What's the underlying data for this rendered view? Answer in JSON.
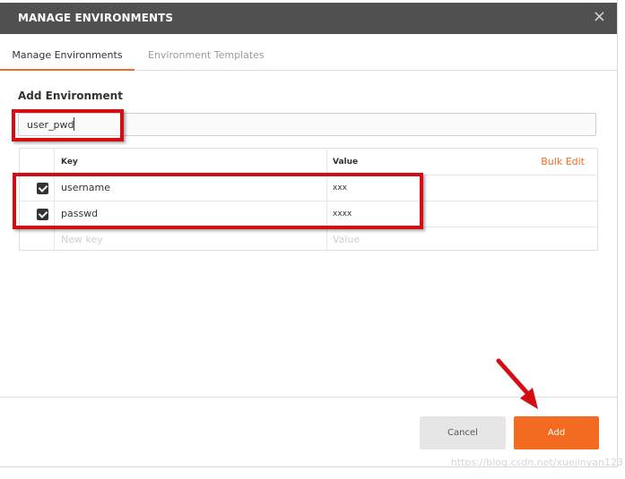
{
  "dialog": {
    "title": "MANAGE ENVIRONMENTS",
    "close_icon": "×"
  },
  "tabs": [
    {
      "label": "Manage Environments",
      "active": true
    },
    {
      "label": "Environment Templates",
      "active": false
    }
  ],
  "form": {
    "section_label": "Add Environment",
    "env_name_value": "user_pwd"
  },
  "table": {
    "headers": {
      "key": "Key",
      "value": "Value"
    },
    "bulk_edit_label": "Bulk Edit",
    "rows": [
      {
        "checked": true,
        "key": "username",
        "value": "xxx"
      },
      {
        "checked": true,
        "key": "passwd",
        "value": "xxxx"
      }
    ],
    "new_row": {
      "key_placeholder": "New key",
      "value_placeholder": "Value"
    }
  },
  "footer": {
    "cancel_label": "Cancel",
    "add_label": "Add"
  },
  "colors": {
    "accent": "#f26b21",
    "title_bar": "#505050",
    "highlight": "#d40d12"
  },
  "watermark": "https://blog.csdn.net/xuejinyan123"
}
